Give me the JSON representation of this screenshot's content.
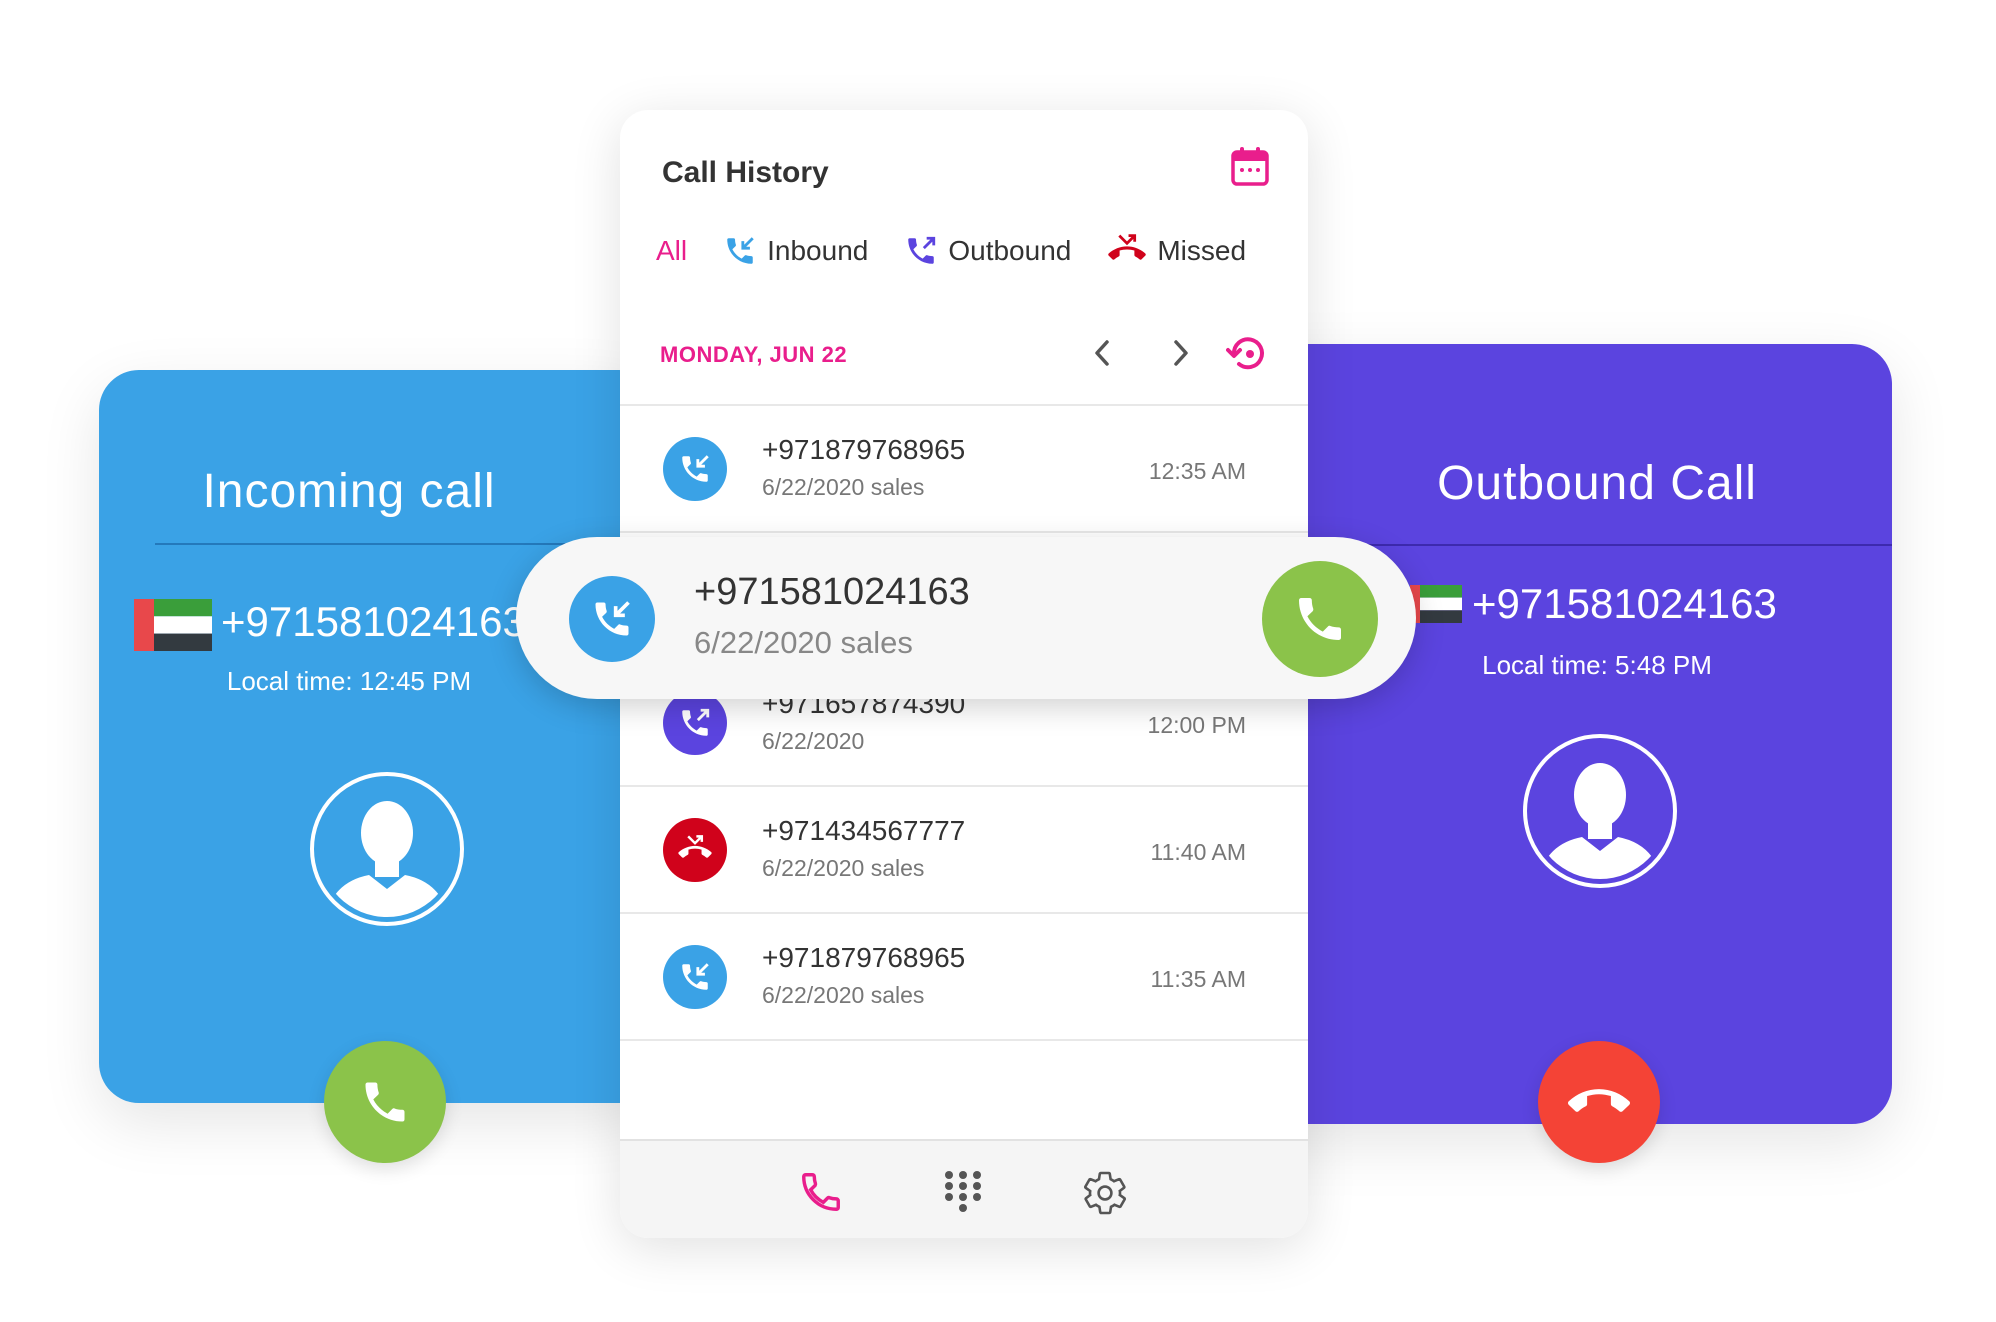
{
  "incoming": {
    "title": "Incoming call",
    "number": "+971581024163",
    "local_time": "Local time: 12:45 PM"
  },
  "outbound": {
    "title": "Outbound Call",
    "number": "+971581024163",
    "local_time": "Local time: 5:48 PM"
  },
  "history": {
    "title": "Call History",
    "filters": [
      "All",
      "Inbound",
      "Outbound",
      "Missed"
    ],
    "date": "MONDAY, JUN 22",
    "rows": [
      {
        "number": "+971879768965",
        "sub": "6/22/2020 sales",
        "time": "12:35 AM",
        "type": "inbound"
      },
      {
        "number": "+971657874390",
        "sub": "6/22/2020",
        "time": "12:00 PM",
        "type": "outbound"
      },
      {
        "number": "+971434567777",
        "sub": "6/22/2020 sales",
        "time": "11:40 AM",
        "type": "missed"
      },
      {
        "number": "+971879768965",
        "sub": "6/22/2020 sales",
        "time": "11:35 AM",
        "type": "inbound"
      }
    ]
  },
  "banner": {
    "number": "+971581024163",
    "sub": "6/22/2020 sales"
  },
  "colors": {
    "incoming_bg": "#3aa2e6",
    "outbound_bg": "#5b44df",
    "accent_pink": "#e91e8c",
    "accept_green": "#8bc34a",
    "hangup_red": "#f44336",
    "missed_red": "#d0021b"
  },
  "icons": {
    "flag": "uae-flag-icon",
    "avatar": "user-avatar-icon",
    "calendar": "calendar-icon",
    "reset": "history-reset-icon"
  }
}
